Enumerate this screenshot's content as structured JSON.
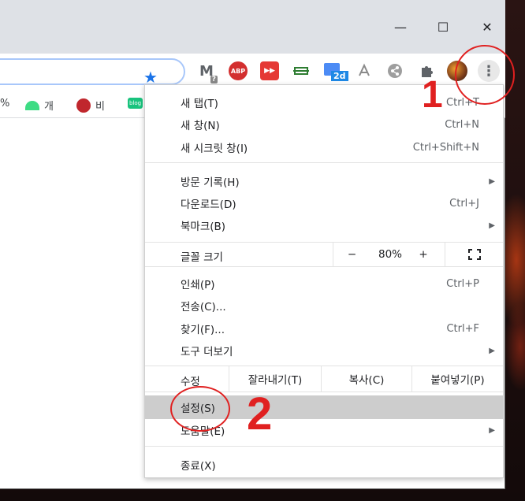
{
  "window": {
    "minimize_glyph": "—",
    "maximize_glyph": "☐",
    "close_glyph": "✕"
  },
  "toolbar": {
    "extensions": [
      {
        "name": "gmail-icon",
        "text": "M",
        "badge": "?",
        "color": "#5f6368"
      },
      {
        "name": "adblock-plus-icon",
        "text": "ABP",
        "color": "#d32f2f"
      },
      {
        "name": "fast-forward-extension-icon",
        "text": "▶▶",
        "color": "#e53935"
      },
      {
        "name": "green-extension-icon",
        "text": "",
        "color": "#2e7d32"
      },
      {
        "name": "calendar-2d-icon",
        "text": "2d",
        "color": "#1e88e5"
      },
      {
        "name": "pdf-icon",
        "text": "",
        "color": "#8a8a8a"
      },
      {
        "name": "share-icon",
        "text": "",
        "color": "#8a8a8a"
      },
      {
        "name": "extensions-puzzle-icon",
        "text": "",
        "color": "#5f6368"
      }
    ],
    "menu_glyph": "⋮"
  },
  "bookmarks": [
    {
      "icon": "percent-fragment",
      "label": "%"
    },
    {
      "icon": "android-icon",
      "label": "개"
    },
    {
      "icon": "vlive-icon",
      "label": "비"
    },
    {
      "icon": "blog-icon",
      "label": "blog"
    }
  ],
  "menu": {
    "new_tab": {
      "label": "새 탭(T)",
      "shortcut": "Ctrl+T"
    },
    "new_window": {
      "label": "새 창(N)",
      "shortcut": "Ctrl+N"
    },
    "new_incognito": {
      "label": "새 시크릿 창(I)",
      "shortcut": "Ctrl+Shift+N"
    },
    "history": {
      "label": "방문 기록(H)"
    },
    "downloads": {
      "label": "다운로드(D)",
      "shortcut": "Ctrl+J"
    },
    "bookmarks": {
      "label": "북마크(B)"
    },
    "zoom": {
      "label": "글꼴 크기",
      "minus": "−",
      "value": "80%",
      "plus": "+"
    },
    "print": {
      "label": "인쇄(P)",
      "shortcut": "Ctrl+P"
    },
    "cast": {
      "label": "전송(C)..."
    },
    "find": {
      "label": "찾기(F)...",
      "shortcut": "Ctrl+F"
    },
    "more_tools": {
      "label": "도구 더보기"
    },
    "edit": {
      "label": "수정",
      "cut": "잘라내기(T)",
      "copy": "복사(C)",
      "paste": "붙여넣기(P)"
    },
    "settings": {
      "label": "설정(S)"
    },
    "help": {
      "label": "도움말(E)"
    },
    "exit": {
      "label": "종료(X)"
    }
  },
  "annotations": {
    "step1": "1",
    "step2": "2"
  },
  "colors": {
    "accent": "#1a73e8",
    "annotation": "#e02020",
    "highlight": "#cdcdcd"
  }
}
